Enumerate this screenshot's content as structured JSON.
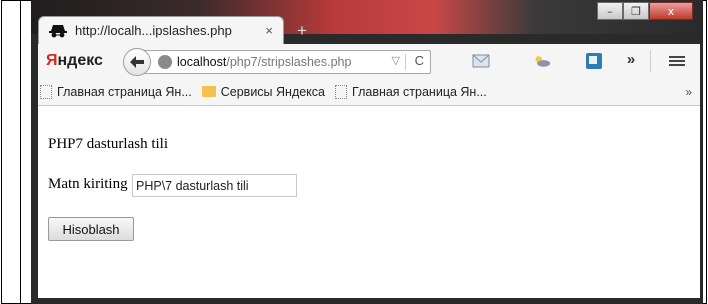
{
  "window": {
    "controls": [
      "–",
      "❐",
      "x"
    ]
  },
  "tab": {
    "title": "http://localh...ipslashes.php",
    "close": "×",
    "new_tab": "+"
  },
  "navbar": {
    "logo_first": "Я",
    "logo_rest": "ндекс",
    "url_host": "localhost",
    "url_path": "/php7/stripslashes.php",
    "url_dropdown": "▽",
    "url_reload": "C",
    "more": "»"
  },
  "bookmarks": {
    "items": [
      "Главная страница Ян...",
      "Сервисы Яндекса",
      "Главная страница Ян..."
    ],
    "overflow": "»"
  },
  "page": {
    "heading": "PHP7 dasturlash tili",
    "input_label": "Matn kiriting",
    "input_value": "PHP\\7 dasturlash tili",
    "button_label": "Hisoblash"
  }
}
